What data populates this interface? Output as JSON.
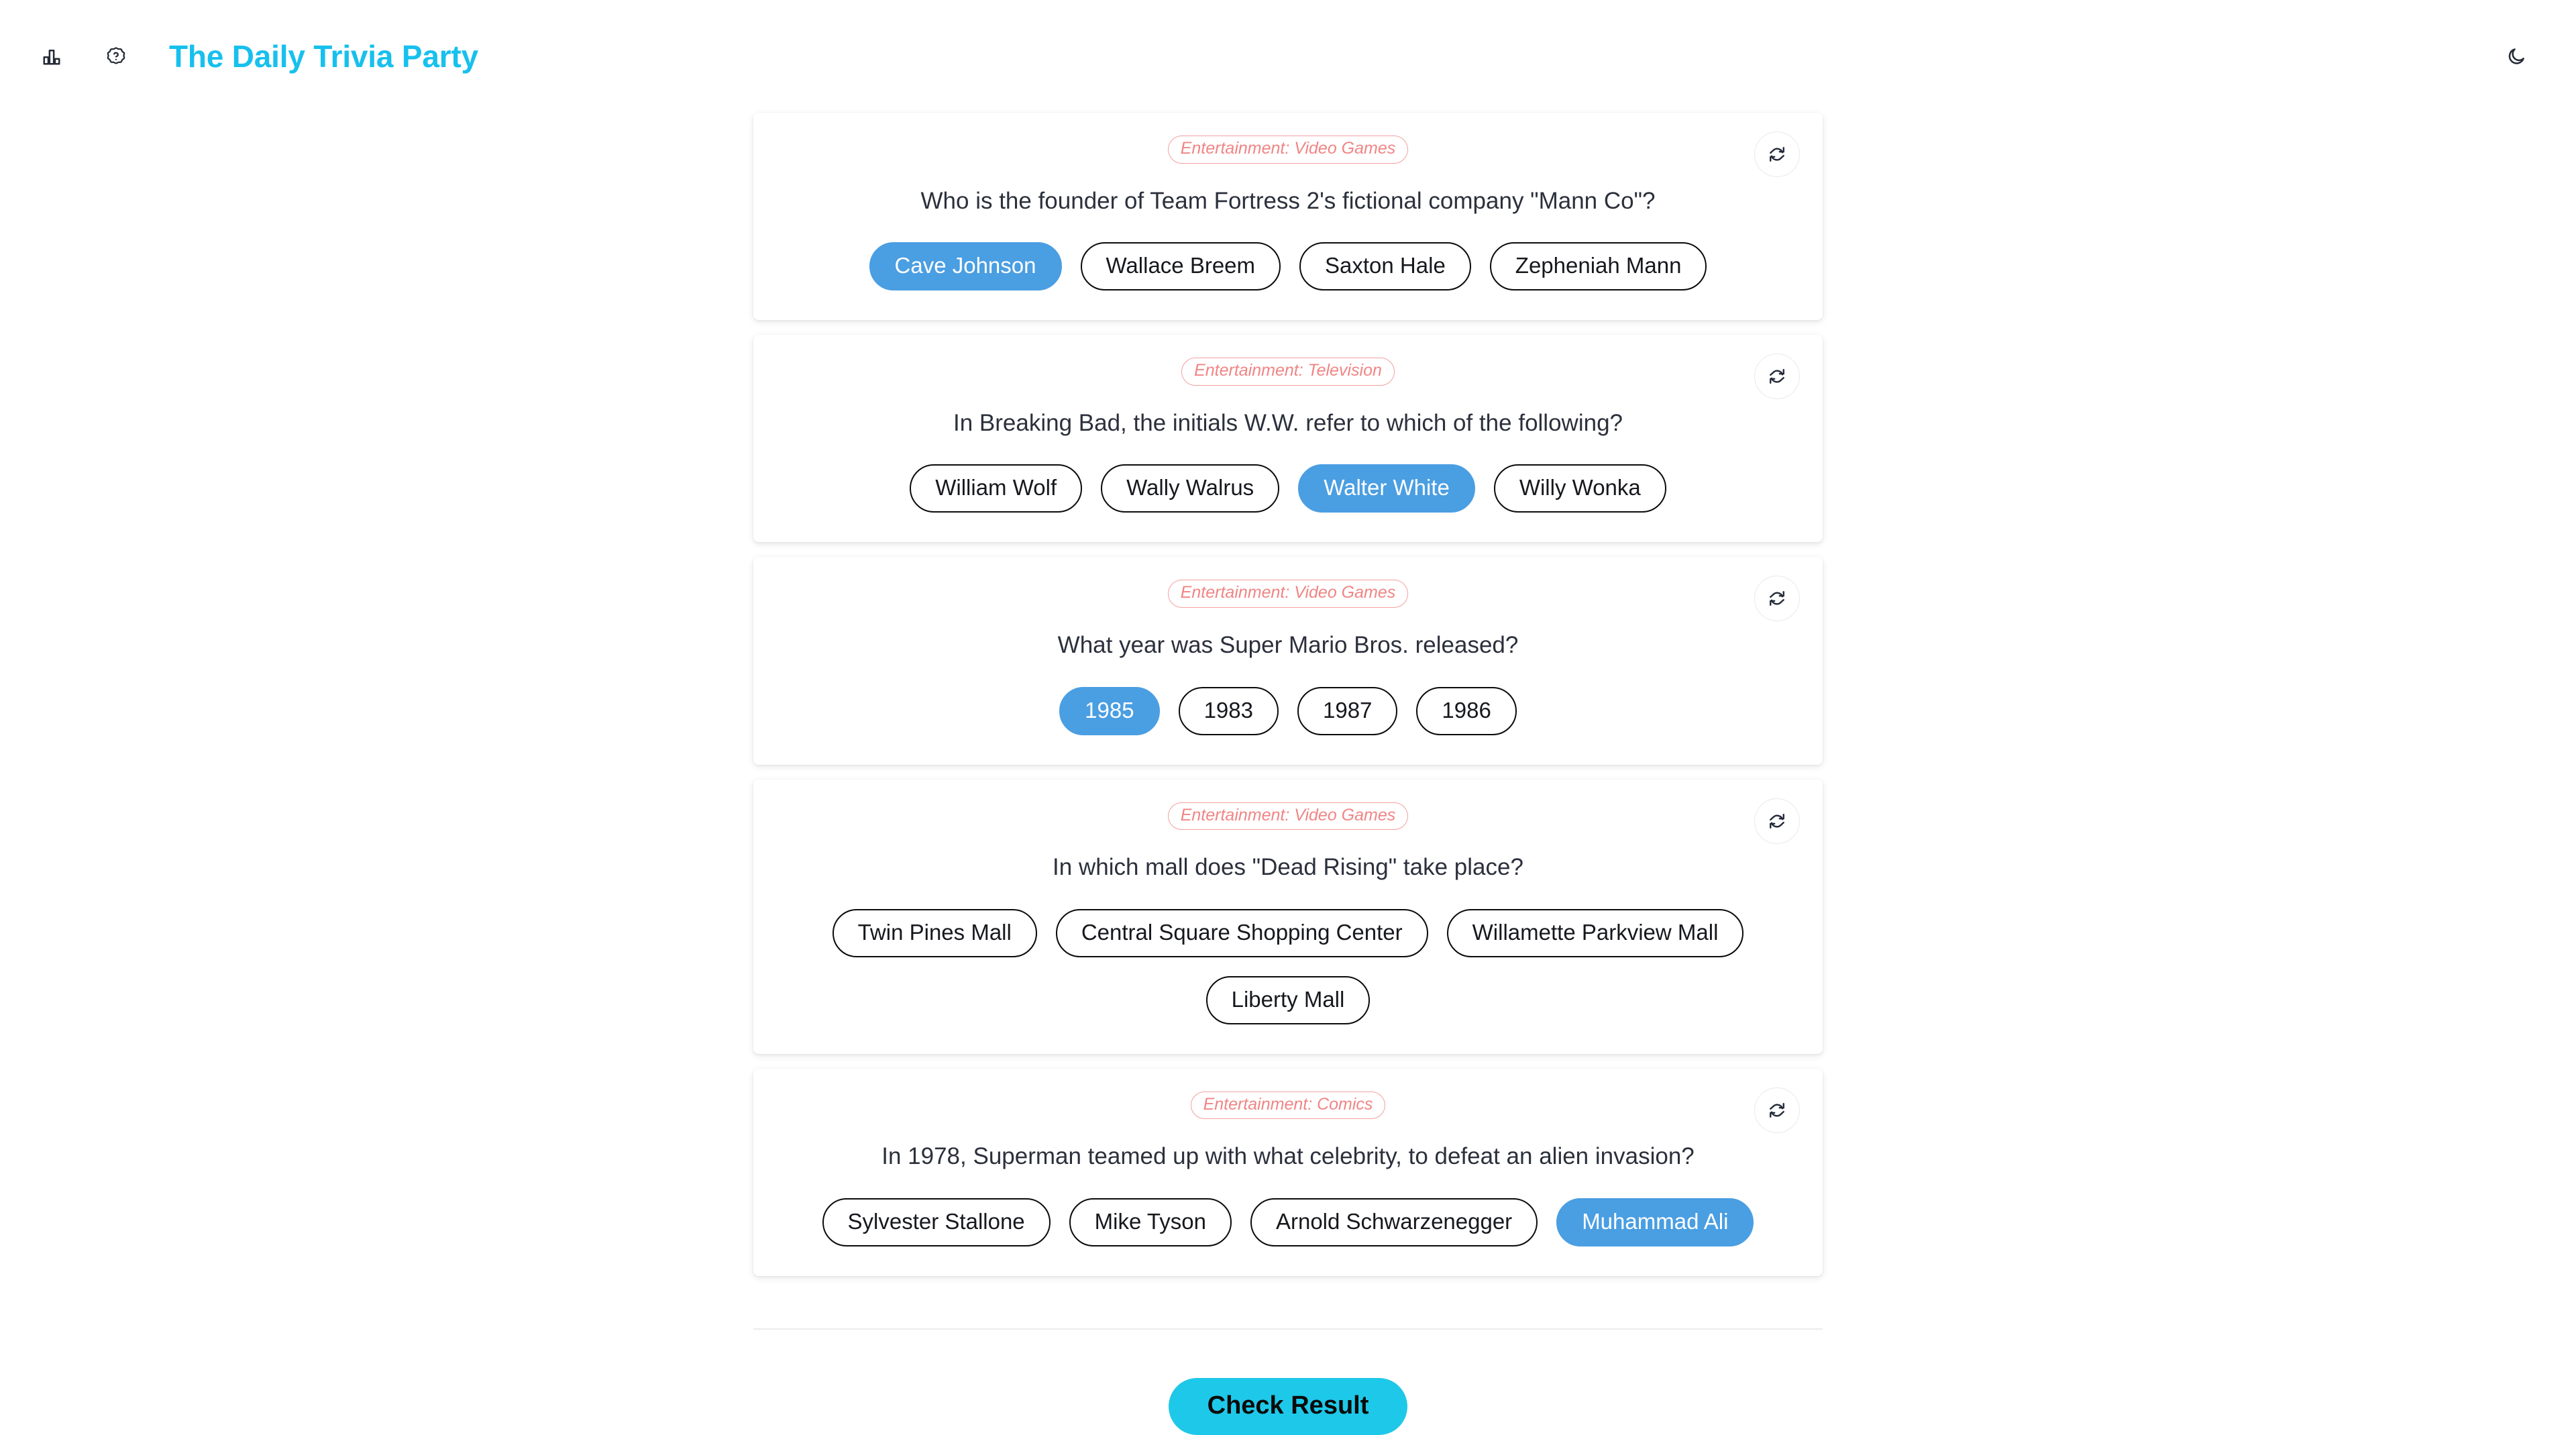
{
  "header": {
    "title": "The Daily Trivia Party",
    "stats_icon": "bar-chart-icon",
    "help_icon": "question-badge-icon",
    "theme_icon": "moon-icon",
    "title_color": "#17c0ed"
  },
  "theme": {
    "accent": "#17c0ed",
    "selected_answer": "#4a9ee2",
    "category_color": "#f08585",
    "submit_bg": "#1ec8e8",
    "question_color": "#2b303c",
    "page_bg": "#ffffff"
  },
  "questions": [
    {
      "category": "Entertainment: Video Games",
      "question": "Who is the founder of Team Fortress 2's fictional company \"Mann Co\"?",
      "refresh_label": "refresh-icon",
      "answers": [
        {
          "label": "Cave Johnson",
          "selected": true
        },
        {
          "label": "Wallace Breem",
          "selected": false
        },
        {
          "label": "Saxton Hale",
          "selected": false
        },
        {
          "label": "Zepheniah Mann",
          "selected": false
        }
      ]
    },
    {
      "category": "Entertainment: Television",
      "question": "In Breaking Bad, the initials W.W. refer to which of the following?",
      "refresh_label": "refresh-icon",
      "answers": [
        {
          "label": "William Wolf",
          "selected": false
        },
        {
          "label": "Wally Walrus",
          "selected": false
        },
        {
          "label": "Walter White",
          "selected": true
        },
        {
          "label": "Willy Wonka",
          "selected": false
        }
      ]
    },
    {
      "category": "Entertainment: Video Games",
      "question": "What year was Super Mario Bros. released?",
      "refresh_label": "refresh-icon",
      "answers": [
        {
          "label": "1985",
          "selected": true
        },
        {
          "label": "1983",
          "selected": false
        },
        {
          "label": "1987",
          "selected": false
        },
        {
          "label": "1986",
          "selected": false
        }
      ]
    },
    {
      "category": "Entertainment: Video Games",
      "question": "In which mall does \"Dead Rising\" take place?",
      "refresh_label": "refresh-icon",
      "answers": [
        {
          "label": "Twin Pines Mall",
          "selected": false
        },
        {
          "label": "Central Square Shopping Center",
          "selected": false
        },
        {
          "label": "Willamette Parkview Mall",
          "selected": false
        },
        {
          "label": "Liberty Mall",
          "selected": false
        }
      ]
    },
    {
      "category": "Entertainment: Comics",
      "question": "In 1978, Superman teamed up with what celebrity, to defeat an alien invasion?",
      "refresh_label": "refresh-icon",
      "answers": [
        {
          "label": "Sylvester Stallone",
          "selected": false
        },
        {
          "label": "Mike Tyson",
          "selected": false
        },
        {
          "label": "Arnold Schwarzenegger",
          "selected": false
        },
        {
          "label": "Muhammad Ali",
          "selected": true
        }
      ]
    }
  ],
  "footer": {
    "submit_label": "Check Result"
  }
}
